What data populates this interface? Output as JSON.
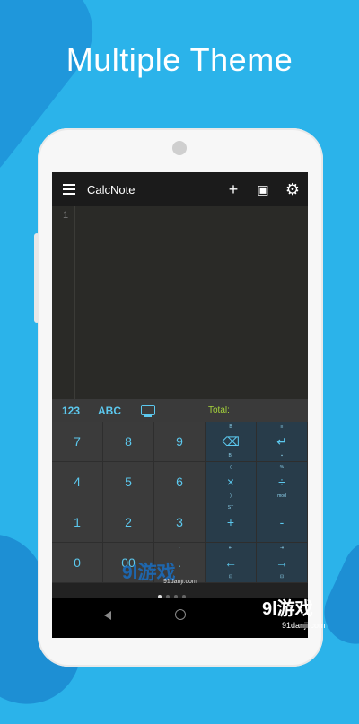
{
  "headline": "Multiple Theme",
  "app": {
    "title": "CalcNote",
    "toolbar": [
      {
        "name": "add-button",
        "icon": "plus-icon",
        "glyph": "+"
      },
      {
        "name": "new-folder-button",
        "icon": "folder-plus-icon",
        "glyph": "▣"
      },
      {
        "name": "settings-button",
        "icon": "gear-icon",
        "glyph": "⚙"
      }
    ]
  },
  "editor": {
    "line_number": "1"
  },
  "keyboard_bar": {
    "tab_numbers": "123",
    "tab_letters": "ABC",
    "keyboard_icon": "keyboard-icon",
    "total_label": "Total:"
  },
  "keypad": {
    "rows": [
      [
        {
          "main": "7"
        },
        {
          "main": "8"
        },
        {
          "main": "9"
        },
        {
          "main": "⌫",
          "top": "B",
          "bottom": "B·",
          "op": true
        },
        {
          "main": "↵",
          "top": "≡",
          "bottom": "▪",
          "op": true
        }
      ],
      [
        {
          "main": "4"
        },
        {
          "main": "5"
        },
        {
          "main": "6"
        },
        {
          "main": "×",
          "top": "(",
          "bottom": ")",
          "op": true
        },
        {
          "main": "÷",
          "top": "%",
          "bottom": "mod",
          "op": true
        }
      ],
      [
        {
          "main": "1"
        },
        {
          "main": "2"
        },
        {
          "main": "3"
        },
        {
          "main": "+",
          "top": "ST",
          "op": true
        },
        {
          "main": "-",
          "op": true
        }
      ],
      [
        {
          "main": "0"
        },
        {
          "main": "00"
        },
        {
          "main": ".",
          "top": "·"
        },
        {
          "main": "←",
          "top": "⇤",
          "bottom": "⊡",
          "op": true
        },
        {
          "main": "→",
          "top": "⇥",
          "bottom": "⊡",
          "op": true
        }
      ]
    ]
  },
  "watermarks": {
    "left": "9l游戏",
    "left_sub": "91danji.com",
    "right": "9l游戏",
    "right_sub": "91danji.com"
  },
  "colors": {
    "accent": "#5cc8ee",
    "total": "#a5d23a",
    "background": "#2bb3ea"
  }
}
